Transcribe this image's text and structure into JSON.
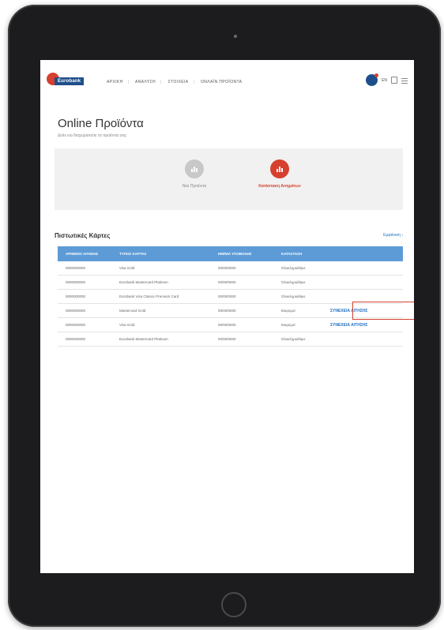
{
  "header": {
    "logo_text": "Eurobank",
    "nav": [
      "ΑΡΧΙΚΗ",
      "ΑΝΑΛΥΣΗ",
      "ΣΤΟΙΧΕΙΑ",
      "ΟΝΛΑΪΝ ΠΡΟΪΟΝΤΑ"
    ],
    "lang": "EN",
    "user_initials": ""
  },
  "page": {
    "title": "Online Προϊόντα",
    "subtitle": "Δείτε και διαχειριστείτε τα προϊόντα σας"
  },
  "panel": {
    "option1_label": "Νέα Προϊόντα",
    "option2_label": "Κατάσταση Αιτημάτων"
  },
  "section": {
    "title": "Πιστωτικές Κάρτες",
    "link": "Εμφάνιση"
  },
  "table": {
    "headers": [
      "ΑΡΙΘΜΟΣ ΑΙΤΗΣΗΣ",
      "ΤΥΠΟΣ ΚΑΡΤΑΣ",
      "ΗΜ/ΝΙΑ ΥΠΟΒΟΛΗΣ",
      "ΚΑΤΑΣΤΑΣΗ",
      ""
    ],
    "rows": [
      [
        "0000000000",
        "Visa Gold",
        "00/00/0000",
        "Ολοκληρώθηκε",
        ""
      ],
      [
        "0000000000",
        "Eurobank Mastercard Platinum",
        "00/00/0000",
        "Ολοκληρώθηκε",
        ""
      ],
      [
        "0000000000",
        "Eurobank Visa Classic Premium Card",
        "00/00/0000",
        "Ολοκληρώθηκε",
        ""
      ],
      [
        "0000000000",
        "Mastercard Gold",
        "00/00/0000",
        "Εκκρεμεί",
        "ΣΥΝΕΧΕΙΑ ΑΙΤΗΣΗΣ"
      ],
      [
        "0000000000",
        "Visa Gold",
        "00/00/0000",
        "Εκκρεμεί",
        "ΣΥΝΕΧΕΙΑ ΑΙΤΗΣΗΣ"
      ],
      [
        "0000000000",
        "Eurobank Mastercard Platinum",
        "00/00/0000",
        "Ολοκληρώθηκε",
        ""
      ]
    ]
  },
  "colors": {
    "brand_red": "#d6402e",
    "brand_blue": "#1f4f8b",
    "table_header": "#5d9bd6",
    "link_blue": "#1f6fbf"
  }
}
